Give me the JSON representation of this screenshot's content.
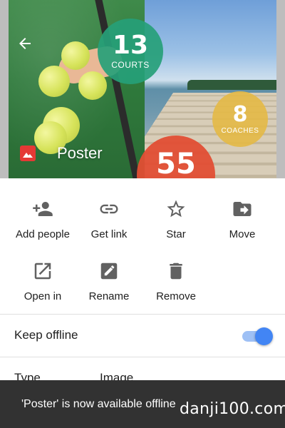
{
  "preview": {
    "title": "Poster",
    "back_icon": "arrow-back-icon",
    "file_type_icon": "image-file-icon",
    "stats": {
      "courts_value": "13",
      "courts_label": "COURTS",
      "coaches_value": "8",
      "coaches_label": "COACHES",
      "third_value": "55"
    }
  },
  "actions": [
    {
      "label": "Add people",
      "icon": "person-add-icon"
    },
    {
      "label": "Get link",
      "icon": "link-icon"
    },
    {
      "label": "Star",
      "icon": "star-outline-icon"
    },
    {
      "label": "Move",
      "icon": "move-to-folder-icon"
    },
    {
      "label": "Open in",
      "icon": "open-in-new-icon"
    },
    {
      "label": "Rename",
      "icon": "edit-icon"
    },
    {
      "label": "Remove",
      "icon": "trash-icon"
    }
  ],
  "offline": {
    "label": "Keep offline",
    "enabled": true,
    "accent_color": "#4285f4"
  },
  "details": {
    "type_label": "Type",
    "type_value": "Image"
  },
  "snackbar": {
    "message": "'Poster' is now available offline"
  },
  "watermark": "danji100.com",
  "colors": {
    "icon_gray": "#616161",
    "file_icon_red": "#e53935",
    "courts_circle": "#26a078",
    "coaches_circle": "#e4ba48",
    "third_circle": "#e24e34",
    "snackbar_bg": "#323232"
  }
}
